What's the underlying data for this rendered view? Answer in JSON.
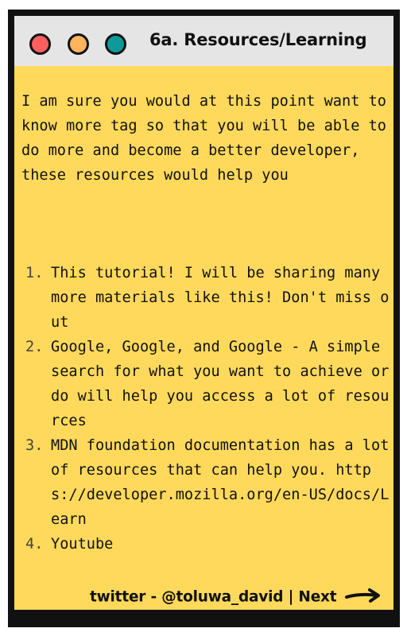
{
  "window": {
    "title": "6a. Resources/Learning",
    "buttons": [
      {
        "name": "close",
        "color": "#ff5f5f"
      },
      {
        "name": "minimize",
        "color": "#ffb35c"
      },
      {
        "name": "maximize",
        "color": "#0e9a9a"
      }
    ]
  },
  "intro": "I am sure you would at this point want to know more tag so that you will be able to do more and become a better developer, these resources would help you",
  "resources": [
    {
      "number": "1.",
      "text": "This tutorial!  I will be sharing many more materials like this! Don't miss out"
    },
    {
      "number": "2.",
      "text": "Google, Google, and Google - A simple search for what you want to achieve or do will help you access a lot of resources"
    },
    {
      "number": "3.",
      "text": " MDN foundation documentation has a lot of resources that can help you. https://developer.mozilla.org/en-US/docs/Learn"
    },
    {
      "number": "4.",
      "text": " Youtube"
    }
  ],
  "footer": {
    "twitter": "twitter - @toluwa_david",
    "separator": " | ",
    "next_label": "Next"
  },
  "colors": {
    "frame": "#111111",
    "titlebar": "#e5e5e5",
    "content": "#ffd95c"
  }
}
